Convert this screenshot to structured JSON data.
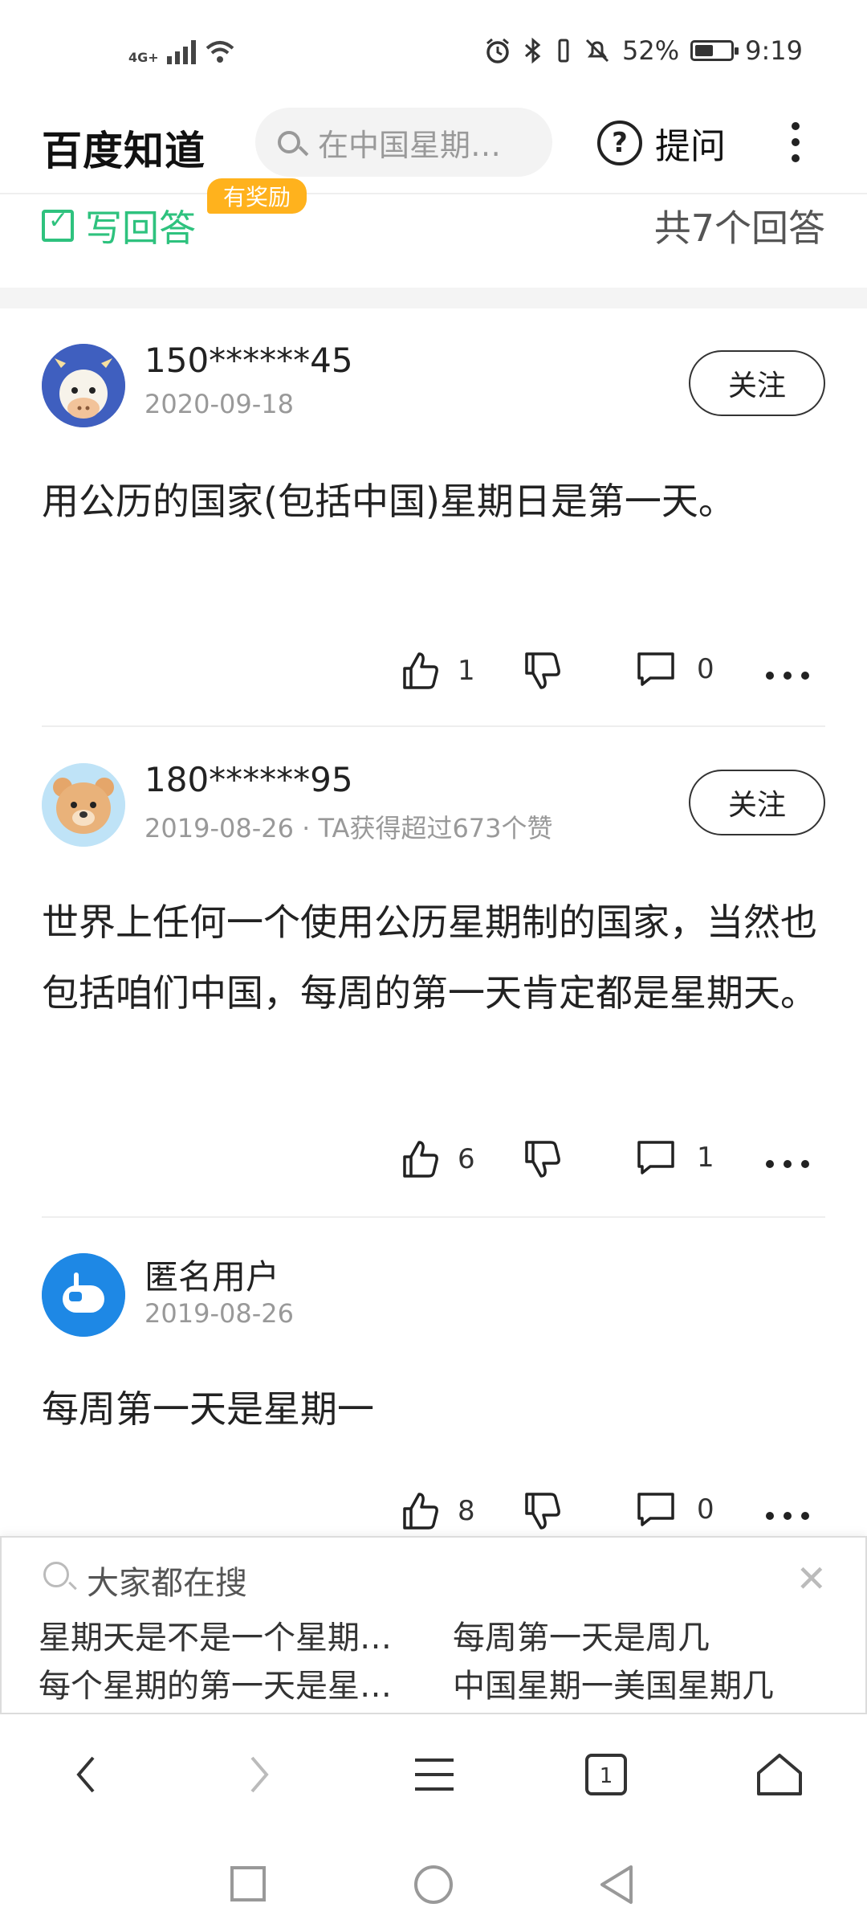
{
  "status_bar": {
    "network": "4G+",
    "battery": "52%",
    "battery_level": 0.52,
    "time": "9:19"
  },
  "header": {
    "logo": "百度知道",
    "search_placeholder": "在中国星期…",
    "ask_label": "提问"
  },
  "answer_bar": {
    "write_label": "写回答",
    "reward_badge": "有奖励",
    "count": "共7个回答"
  },
  "answers": [
    {
      "user": "150******45",
      "meta": "2020-09-18",
      "follow": "关注",
      "content": "用公历的国家(包括中国)星期日是第一天。",
      "likes": "1",
      "comments": "0"
    },
    {
      "user": "180******95",
      "meta": "2019-08-26 · TA获得超过673个赞",
      "follow": "关注",
      "content": "世界上任何一个使用公历星期制的国家，当然也包括咱们中国，每周的第一天肯定都是星期天。",
      "likes": "6",
      "comments": "1"
    },
    {
      "user": "匿名用户",
      "meta": "2019-08-26",
      "follow": "",
      "content": "每周第一天是星期一",
      "likes": "8",
      "comments": "0"
    }
  ],
  "popular_search": {
    "title": "大家都在搜",
    "items": [
      "星期天是不是一个星期…",
      "每周第一天是周几",
      "每个星期的第一天是星…",
      "中国星期一美国星期几"
    ]
  },
  "browser_nav": {
    "tab_count": "1"
  }
}
